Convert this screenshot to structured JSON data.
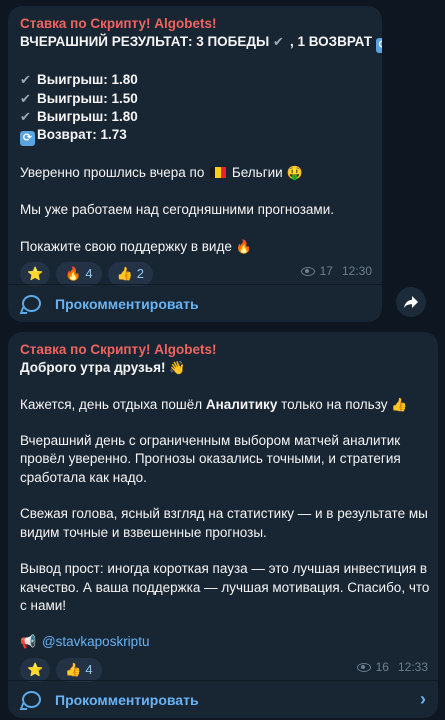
{
  "messages": [
    {
      "sender": "Ставка по Скрипту! Algobets!",
      "headline_a": "ВЧЕРАШНИЙ РЕЗУЛЬТАТ: 3 ПОБЕДЫ",
      "headline_b": ", 1 ВОЗВРАТ",
      "results": [
        {
          "label": "Выигрыш: 1.80"
        },
        {
          "label": "Выигрыш: 1.50"
        },
        {
          "label": "Выигрыш: 1.80"
        },
        {
          "label": "Возврат: 1.73"
        }
      ],
      "confident_a": "Уверенно прошлись вчера по",
      "confident_b": "Бельгии",
      "working": "Мы уже работаем над сегодняшними прогнозами.",
      "support": "Покажите свою поддержку в виде",
      "reactions": [
        {
          "icon": "star-icon",
          "count": ""
        },
        {
          "icon": "fire-icon",
          "count": "4"
        },
        {
          "icon": "thumbs-up-icon",
          "count": "2"
        }
      ],
      "views": "17",
      "time": "12:30",
      "comment_label": "Прокомментировать"
    },
    {
      "sender": "Ставка по Скрипту! Algobets!",
      "greeting": "Доброго утра друзья!",
      "p1_a": "Кажется, день отдыха пошёл ",
      "p1_bold": "Аналитику",
      "p1_b": " только на пользу",
      "p2_l1": "Вчерашний день с ограниченным выбором матчей аналитик",
      "p2_l2": "провёл уверенно. Прогнозы оказались точными, и стратегия",
      "p2_l3": "сработала как надо.",
      "p3_l1": "Свежая голова, ясный взгляд на статистику — и в результате мы",
      "p3_l2": "видим точные и взвешенные прогнозы.",
      "p4_l1": "Вывод прост: иногда короткая пауза — это лучшая инвестиция в",
      "p4_l2": "качество. А ваша поддержка — лучшая мотивация. Спасибо, что",
      "p4_l3": "с нами!",
      "handle": "@stavkaposkriptu",
      "reactions": [
        {
          "icon": "star-icon",
          "count": ""
        },
        {
          "icon": "thumbs-up-icon",
          "count": "4"
        }
      ],
      "views": "16",
      "time": "12:33",
      "comment_label": "Прокомментировать"
    }
  ],
  "colors": {
    "background": "#0e1621",
    "bubble": "#182533",
    "sender": "#f0645f",
    "link": "#6ab3f3",
    "meta": "#6d7f8f"
  }
}
